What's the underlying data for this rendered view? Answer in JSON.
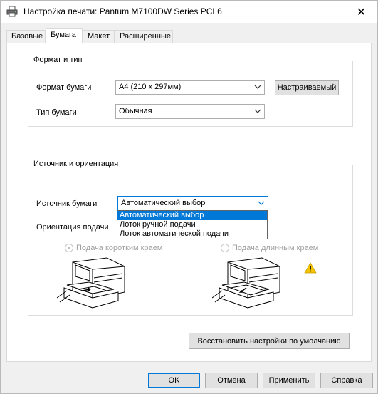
{
  "window": {
    "title": "Настройка печати: Pantum M7100DW Series PCL6",
    "close_glyph": "✕"
  },
  "tabs": [
    {
      "label": "Базовые",
      "active": false
    },
    {
      "label": "Бумага",
      "active": true
    },
    {
      "label": "Макет",
      "active": false
    },
    {
      "label": "Расширенные",
      "active": false
    }
  ],
  "format_group": {
    "title": "Формат и тип",
    "paper_size_label": "Формат бумаги",
    "paper_size_value": "A4 (210 x 297мм)",
    "custom_button": "Настраиваемый",
    "paper_type_label": "Тип бумаги",
    "paper_type_value": "Обычная"
  },
  "source_group": {
    "title": "Источник и ориентация",
    "source_label": "Источник бумаги",
    "source_value": "Автоматический выбор",
    "source_options": [
      "Автоматический выбор",
      "Лоток ручной подачи",
      "Лоток автоматической подачи"
    ],
    "selected_option_index": 0,
    "feed_label": "Ориентация подачи",
    "short_edge_label": "Подача коротким краем",
    "long_edge_label": "Подача длинным краем",
    "short_edge_checked": true,
    "long_edge_checked": false
  },
  "restore_button": "Восстановить настройки по умолчанию",
  "footer": {
    "ok": "OK",
    "cancel": "Отмена",
    "apply": "Применить",
    "help": "Справка"
  },
  "icons": {
    "app": "printer-icon",
    "warning": "warning-icon",
    "dropdown": "chevron-down-icon"
  },
  "colors": {
    "accent": "#0078d7",
    "warning": "#f5c400"
  }
}
